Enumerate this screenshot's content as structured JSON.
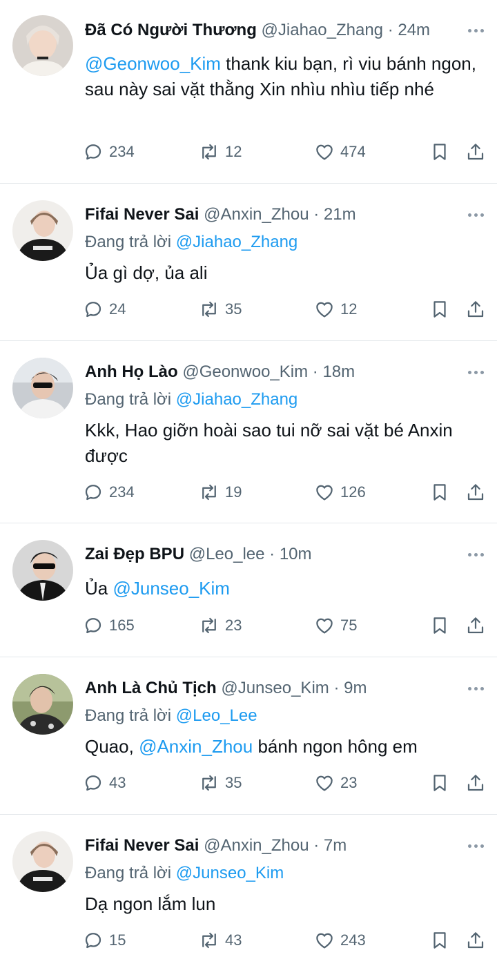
{
  "colors": {
    "mention": "#1d9bf0",
    "secondary_text": "#536471",
    "divider": "#e3e7ea"
  },
  "tweets": [
    {
      "name": "Đã Có Người Thương",
      "handle": "@Jiahao_Zhang",
      "dot": "·",
      "time": "24m",
      "reply_prefix": "",
      "reply_to": "",
      "text_mention": "@Geonwoo_Kim",
      "text_before": "",
      "text_after": " thank kiu bạn, rì viu bánh ngon, sau này sai vặt thằng Xin nhìu nhìu tiếp nhé",
      "replies": "234",
      "retweets": "12",
      "likes": "474"
    },
    {
      "name": "Fifai Never Sai",
      "handle": "@Anxin_Zhou",
      "dot": "·",
      "time": "21m",
      "reply_prefix": "Đang trả lời",
      "reply_to": "@Jiahao_Zhang",
      "text_mention": "",
      "text_before": "Ủa gì dợ, ủa ali",
      "text_after": "",
      "replies": "24",
      "retweets": "35",
      "likes": "12"
    },
    {
      "name": "Anh Họ Lào",
      "handle": "@Geonwoo_Kim",
      "dot": "·",
      "time": "18m",
      "reply_prefix": "Đang trả lời",
      "reply_to": "@Jiahao_Zhang",
      "text_mention": "",
      "text_before": "Kkk, Hao giỡn hoài sao tui nỡ sai vặt bé Anxin được",
      "text_after": "",
      "replies": "234",
      "retweets": "19",
      "likes": "126"
    },
    {
      "name": "Zai Đẹp BPU",
      "handle": "@Leo_lee",
      "dot": "·",
      "time": "10m",
      "reply_prefix": "",
      "reply_to": "",
      "text_mention": "@Junseo_Kim",
      "text_before": "Ủa ",
      "text_after": "",
      "replies": "165",
      "retweets": "23",
      "likes": "75"
    },
    {
      "name": "Anh Là Chủ Tịch",
      "handle": "@Junseo_Kim",
      "dot": "·",
      "time": "9m",
      "reply_prefix": "Đang trả lời",
      "reply_to": "@Leo_Lee",
      "text_mention": "@Anxin_Zhou",
      "text_before": "Quao, ",
      "text_after": " bánh ngon hông em",
      "replies": "43",
      "retweets": "35",
      "likes": "23"
    },
    {
      "name": "Fifai Never Sai",
      "handle": "@Anxin_Zhou",
      "dot": "·",
      "time": "7m",
      "reply_prefix": "Đang trả lời",
      "reply_to": "@Junseo_Kim",
      "text_mention": "",
      "text_before": "Dạ ngon lắm lun",
      "text_after": "",
      "replies": "15",
      "retweets": "43",
      "likes": "243"
    }
  ]
}
